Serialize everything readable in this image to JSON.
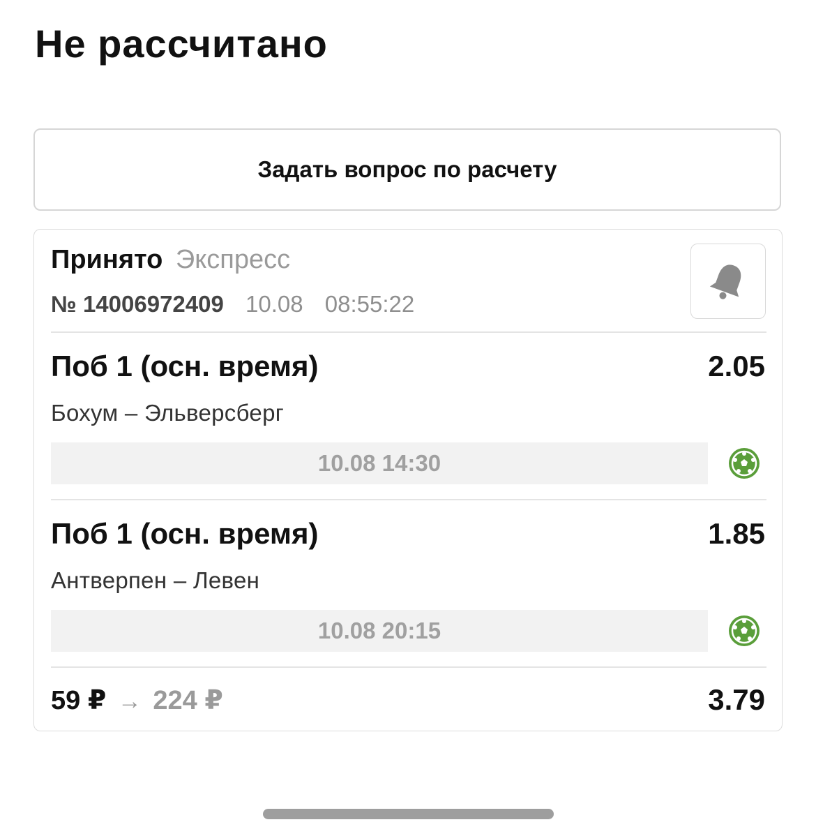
{
  "page": {
    "title": "Не рассчитано"
  },
  "ask_button": {
    "label": "Задать вопрос по расчету"
  },
  "bet": {
    "status": "Принято",
    "type": "Экспресс",
    "number": "№ 14006972409",
    "date": "10.08",
    "time": "08:55:22",
    "events": [
      {
        "market": "Поб 1 (осн. время)",
        "odds": "2.05",
        "teams": "Бохум – Эльверсберг",
        "datetime": "10.08 14:30",
        "sport_icon": "soccer-ball-icon"
      },
      {
        "market": "Поб 1 (осн. время)",
        "odds": "1.85",
        "teams": "Антверпен – Левен",
        "datetime": "10.08 20:15",
        "sport_icon": "soccer-ball-icon"
      }
    ],
    "stake": "59 ₽",
    "arrow": "→",
    "payout": "224 ₽",
    "total_odds": "3.79"
  },
  "colors": {
    "sport_icon": "#5a9e3a",
    "bell_icon": "#8a8a8a"
  },
  "icons": {
    "bell": "bell-icon",
    "sport": "soccer-ball-icon"
  }
}
